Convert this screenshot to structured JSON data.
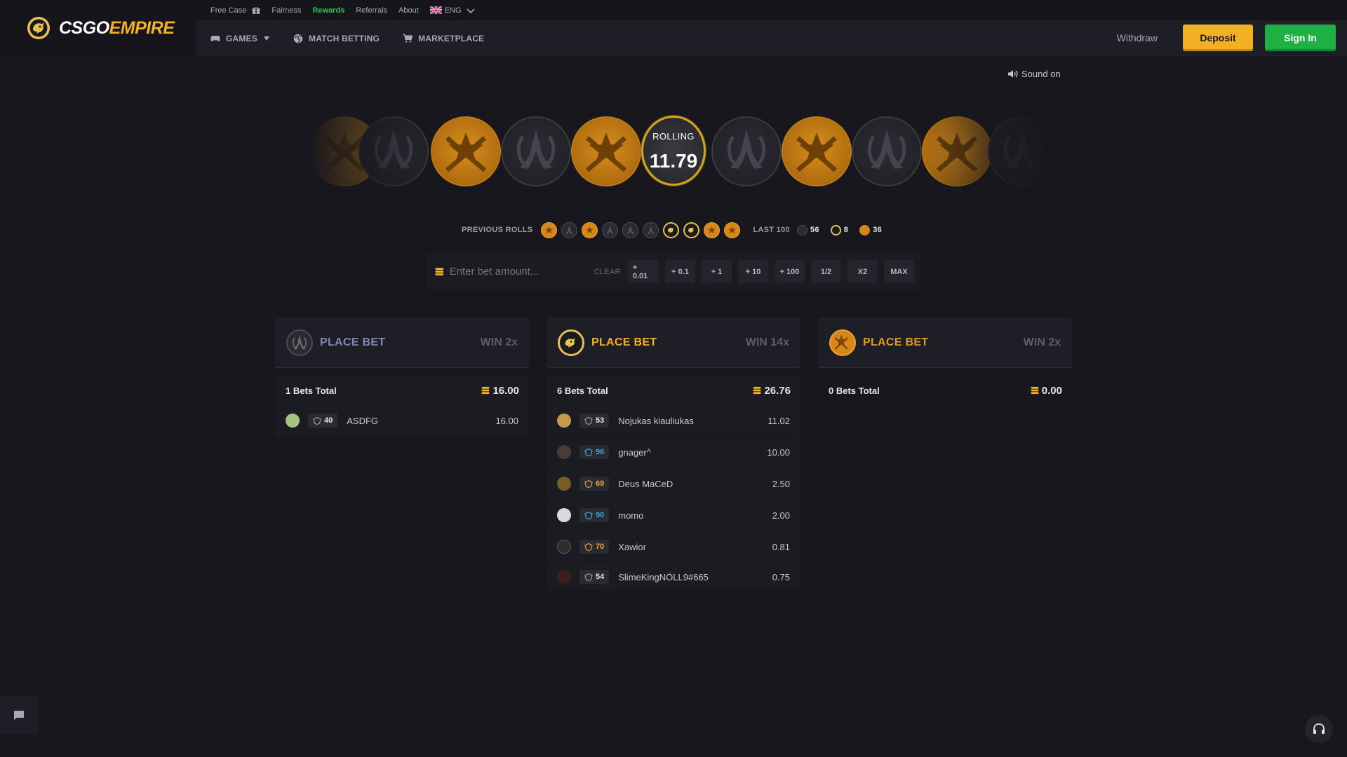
{
  "brand": {
    "name_white": "CSGO",
    "name_yellow": "EMPIRE"
  },
  "toplinks": [
    {
      "label": "Free Case",
      "icon": "gift-icon"
    },
    {
      "label": "Fairness"
    },
    {
      "label": "Rewards",
      "active": true
    },
    {
      "label": "Referrals"
    },
    {
      "label": "About"
    },
    {
      "label": "ENG",
      "icon": "uk-flag-icon"
    }
  ],
  "nav": {
    "games": "GAMES",
    "match_betting": "MATCH BETTING",
    "marketplace": "MARKETPLACE"
  },
  "header_actions": {
    "withdraw": "Withdraw",
    "deposit": "Deposit",
    "sign_in": "Sign In"
  },
  "sound": {
    "label": "Sound on"
  },
  "roll": {
    "label": "ROLLING",
    "value": "11.79"
  },
  "roulette_strip": [
    "t",
    "ct",
    "t",
    "ct",
    "t",
    "bonus",
    "ct",
    "t",
    "ct",
    "t",
    "ct"
  ],
  "previous_rolls": {
    "label": "PREVIOUS ROLLS",
    "rolls": [
      "t",
      "ct",
      "t",
      "ct",
      "ct",
      "ct",
      "bonus",
      "bonus",
      "t",
      "t"
    ],
    "last100_label": "LAST 100",
    "last100": {
      "ct": "56",
      "bonus": "8",
      "t": "36"
    }
  },
  "bet_input": {
    "placeholder": "Enter bet amount...",
    "clear": "CLEAR",
    "buttons": [
      "+ 0.01",
      "+ 0.1",
      "+ 1",
      "+ 10",
      "+ 100",
      "1/2",
      "X2",
      "MAX"
    ]
  },
  "panels": [
    {
      "side": "ct",
      "title": "PLACE BET",
      "win": "WIN 2x",
      "title_color": "#7a8bb7",
      "total_label": "1 Bets Total",
      "total_amount": "16.00",
      "bets": [
        {
          "level": "40",
          "name": "ASDFG",
          "amount": "16.00",
          "level_color": "#e5e5ea",
          "avatar_color": "#a7c27d"
        }
      ]
    },
    {
      "side": "bonus",
      "title": "PLACE BET",
      "win": "WIN 14x",
      "title_color": "#f2b125",
      "total_label": "6 Bets Total",
      "total_amount": "26.76",
      "bets": [
        {
          "level": "53",
          "name": "Nojukas kiauliukas",
          "amount": "11.02",
          "level_color": "#e5e5ea",
          "avatar_color": "#c69a4a"
        },
        {
          "level": "96",
          "name": "gnager^",
          "amount": "10.00",
          "level_color": "#3aa7e0",
          "avatar_color": "#4b3a3a"
        },
        {
          "level": "69",
          "name": "Deus MaCeD",
          "amount": "2.50",
          "level_color": "#e0a83a",
          "avatar_color": "#7a5a2a"
        },
        {
          "level": "90",
          "name": "momo",
          "amount": "2.00",
          "level_color": "#3aa7e0",
          "avatar_color": "#d9d9de"
        },
        {
          "level": "70",
          "name": "Xawior",
          "amount": "0.81",
          "level_color": "#e0a83a",
          "avatar_color": "#2a2f2a"
        },
        {
          "level": "54",
          "name": "SlimeKingNÖLL9#665",
          "amount": "0.75",
          "level_color": "#e5e5ea",
          "avatar_color": "#3a1f1f"
        }
      ]
    },
    {
      "side": "t",
      "title": "PLACE BET",
      "win": "WIN 2x",
      "title_color": "#e09a2a",
      "total_label": "0 Bets Total",
      "total_amount": "0.00",
      "bets": []
    }
  ],
  "colors": {
    "accent": "#f2b125",
    "signin": "#1fb043",
    "background": "#17171d"
  }
}
